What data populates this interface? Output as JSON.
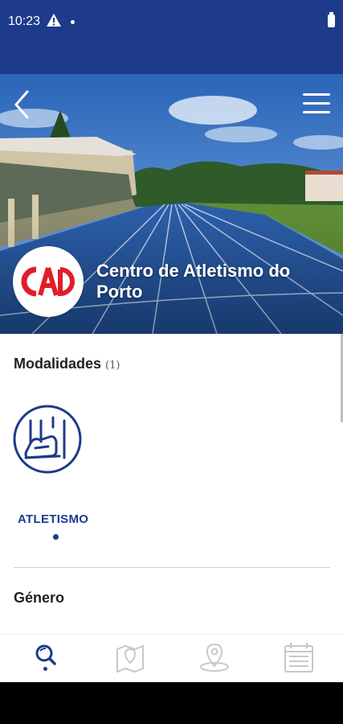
{
  "status_bar": {
    "time": "10:23",
    "icons": [
      "warning-icon",
      "notification-dot",
      "battery-icon"
    ]
  },
  "header": {
    "back_icon": "chevron-left-icon",
    "menu_icon": "hamburger-menu-icon"
  },
  "club": {
    "name": "Centro de Atletismo do Porto",
    "logo_icon": "club-logo"
  },
  "modalidades": {
    "title": "Modalidades",
    "count": "(1)",
    "items": [
      {
        "label": "ATLETISMO",
        "icon": "running-shoe-hurdle-icon",
        "selected": true
      }
    ]
  },
  "genero": {
    "title": "Género"
  },
  "bottom_nav": {
    "items": [
      {
        "icon": "search-icon",
        "active": true
      },
      {
        "icon": "map-icon",
        "active": false
      },
      {
        "icon": "location-pin-icon",
        "active": false
      },
      {
        "icon": "calendar-icon",
        "active": false
      }
    ]
  },
  "colors": {
    "primary": "#1e3a8a",
    "logo_red": "#e11d2a",
    "inactive_icon": "#c8c8c8"
  }
}
